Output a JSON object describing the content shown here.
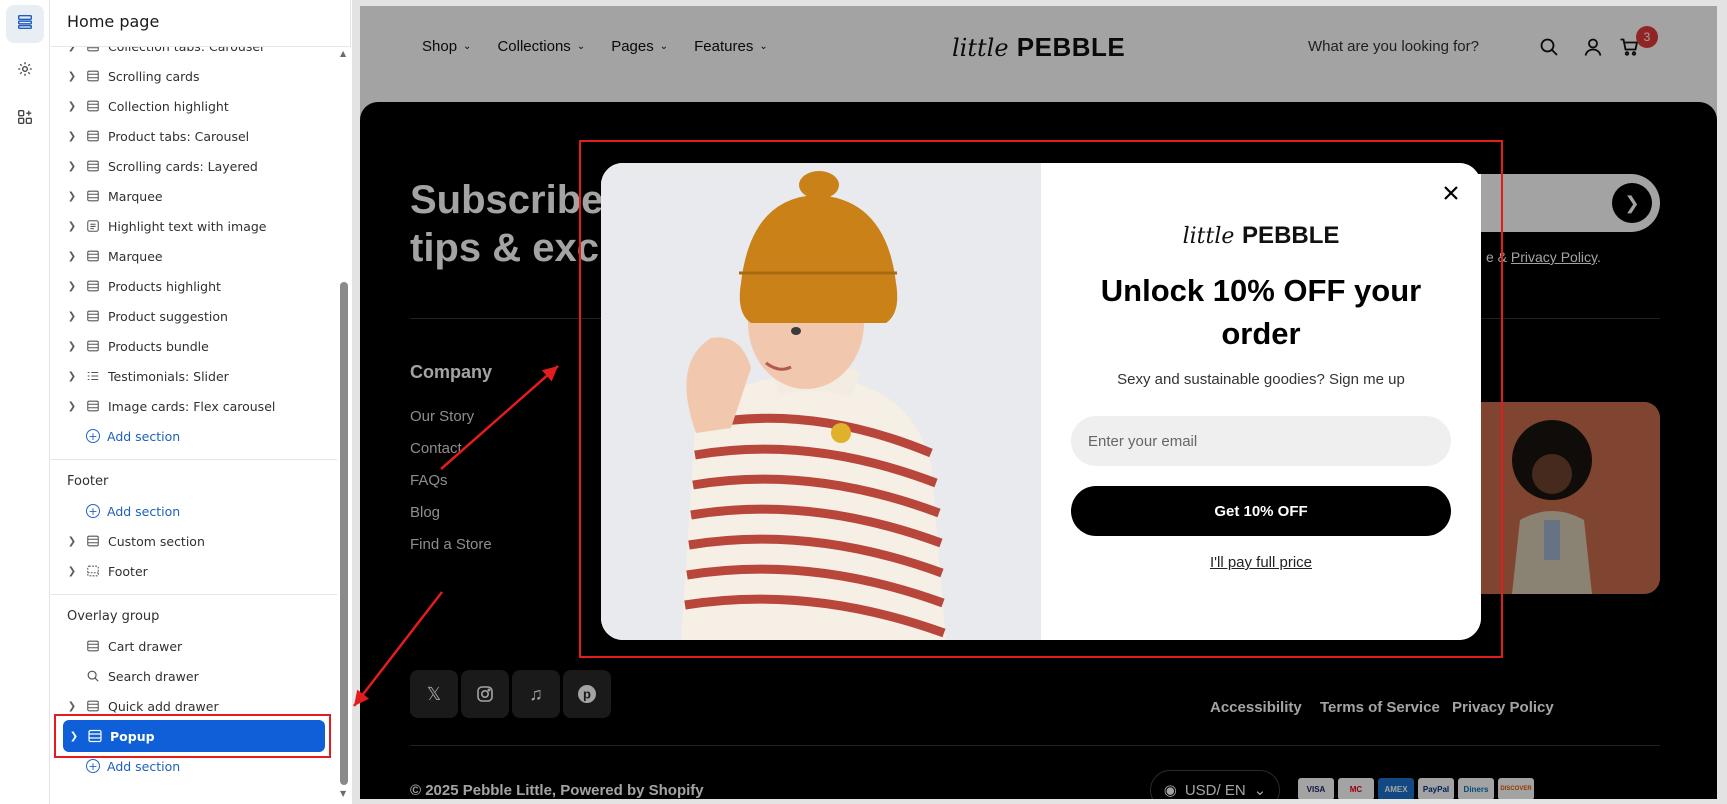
{
  "sidebar": {
    "title": "Home page",
    "template_items": [
      {
        "label": "Collection tabs: Carousel",
        "icon": "section-icon"
      },
      {
        "label": "Scrolling cards",
        "icon": "section-icon"
      },
      {
        "label": "Collection highlight",
        "icon": "section-icon"
      },
      {
        "label": "Product tabs: Carousel",
        "icon": "section-icon"
      },
      {
        "label": "Scrolling cards: Layered",
        "icon": "section-icon"
      },
      {
        "label": "Marquee",
        "icon": "section-icon"
      },
      {
        "label": "Highlight text with image",
        "icon": "text-section-icon"
      },
      {
        "label": "Marquee",
        "icon": "section-icon"
      },
      {
        "label": "Products highlight",
        "icon": "section-icon"
      },
      {
        "label": "Product suggestion",
        "icon": "section-icon"
      },
      {
        "label": "Products bundle",
        "icon": "section-icon"
      },
      {
        "label": "Testimonials: Slider",
        "icon": "list-section-icon"
      },
      {
        "label": "Image cards: Flex carousel",
        "icon": "section-icon"
      }
    ],
    "add_section_label": "Add section",
    "footer_group": {
      "title": "Footer",
      "items": [
        {
          "label": "Custom section",
          "icon": "section-icon"
        },
        {
          "label": "Footer",
          "icon": "footer-section-icon"
        }
      ]
    },
    "overlay_group": {
      "title": "Overlay group",
      "items": [
        {
          "label": "Cart drawer",
          "icon": "section-icon"
        },
        {
          "label": "Search drawer",
          "icon": "search-icon"
        },
        {
          "label": "Quick add drawer",
          "icon": "section-icon"
        },
        {
          "label": "Popup",
          "icon": "section-icon",
          "selected": true
        }
      ]
    }
  },
  "store": {
    "nav": [
      "Shop",
      "Collections",
      "Pages",
      "Features"
    ],
    "logo_script": "little",
    "logo_bold": "PEBBLE",
    "search_placeholder": "What are you looking for?",
    "cart_count": "3",
    "footer": {
      "subscribe_title": "Subscribe\ntips & excl",
      "policy_prefix": "e & ",
      "privacy_link": "Privacy Policy",
      "policy_suffix": ".",
      "company_heading": "Company",
      "company_links": [
        "Our Story",
        "Contact",
        "FAQs",
        "Blog",
        "Find a Store"
      ],
      "legal_links": [
        "Accessibility",
        "Terms of Service",
        "Privacy Policy"
      ],
      "copyright": "© 2025 Pebble Little, Powered by Shopify",
      "currency": "USD/ EN",
      "payment_methods": [
        "VISA",
        "MC",
        "AMEX",
        "PayPal",
        "Diners",
        "DISCOVER"
      ]
    }
  },
  "popup": {
    "logo_script": "little",
    "logo_bold": "PEBBLE",
    "title": "Unlock 10% OFF your order",
    "subtitle": "Sexy and sustainable goodies? Sign me up",
    "email_placeholder": "Enter your email",
    "cta": "Get 10% OFF",
    "decline": "I'll pay full price"
  },
  "colors": {
    "selected": "#0e5fd8",
    "annotation": "#e11d1d",
    "popup_cta": "#000000"
  }
}
